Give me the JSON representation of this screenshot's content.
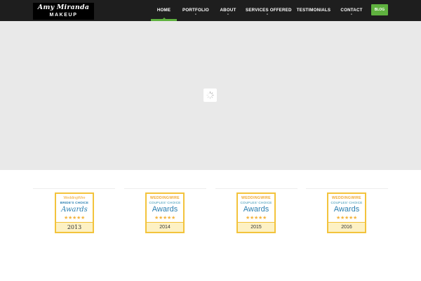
{
  "brand": {
    "line1": "Amy Miranda",
    "line2": "MAKEUP"
  },
  "nav": {
    "items": [
      {
        "label": "HOME",
        "active": true,
        "dropdown": false
      },
      {
        "label": "PORTFOLIO",
        "active": false,
        "dropdown": true
      },
      {
        "label": "ABOUT",
        "active": false,
        "dropdown": true
      },
      {
        "label": "SERVICES OFFERED",
        "active": false,
        "dropdown": true
      },
      {
        "label": "TESTIMONIALS",
        "active": false,
        "dropdown": false
      },
      {
        "label": "CONTACT",
        "active": false,
        "dropdown": true
      }
    ],
    "dropdown_glyph": "-",
    "blog_label": "BLOG"
  },
  "hero": {
    "loader_icon": "spinner-icon"
  },
  "awards": [
    {
      "brand": "WeddingWire",
      "subtitle": "BRIDE'S CHOICE",
      "title": "Awards",
      "stars": "★★★★★",
      "year": "2013"
    },
    {
      "brand": "WEDDINGWIRE",
      "subtitle": "COUPLES' CHOICE",
      "title": "Awards",
      "stars": "★★★★★",
      "year": "2014"
    },
    {
      "brand": "WEDDINGWIRE",
      "subtitle": "COUPLES' CHOICE",
      "title": "Awards",
      "stars": "★★★★★",
      "year": "2015"
    },
    {
      "brand": "WEDDINGWIRE",
      "subtitle": "COUPLES' CHOICE",
      "title": "Awards",
      "stars": "★★★★★",
      "year": "2016"
    }
  ],
  "colors": {
    "topbar": "#1e1e1e",
    "accent": "#5fb13f",
    "hero_bg": "#e9e9e9",
    "badge_border": "#f3c33c",
    "badge_blue": "#2b7fb0"
  }
}
